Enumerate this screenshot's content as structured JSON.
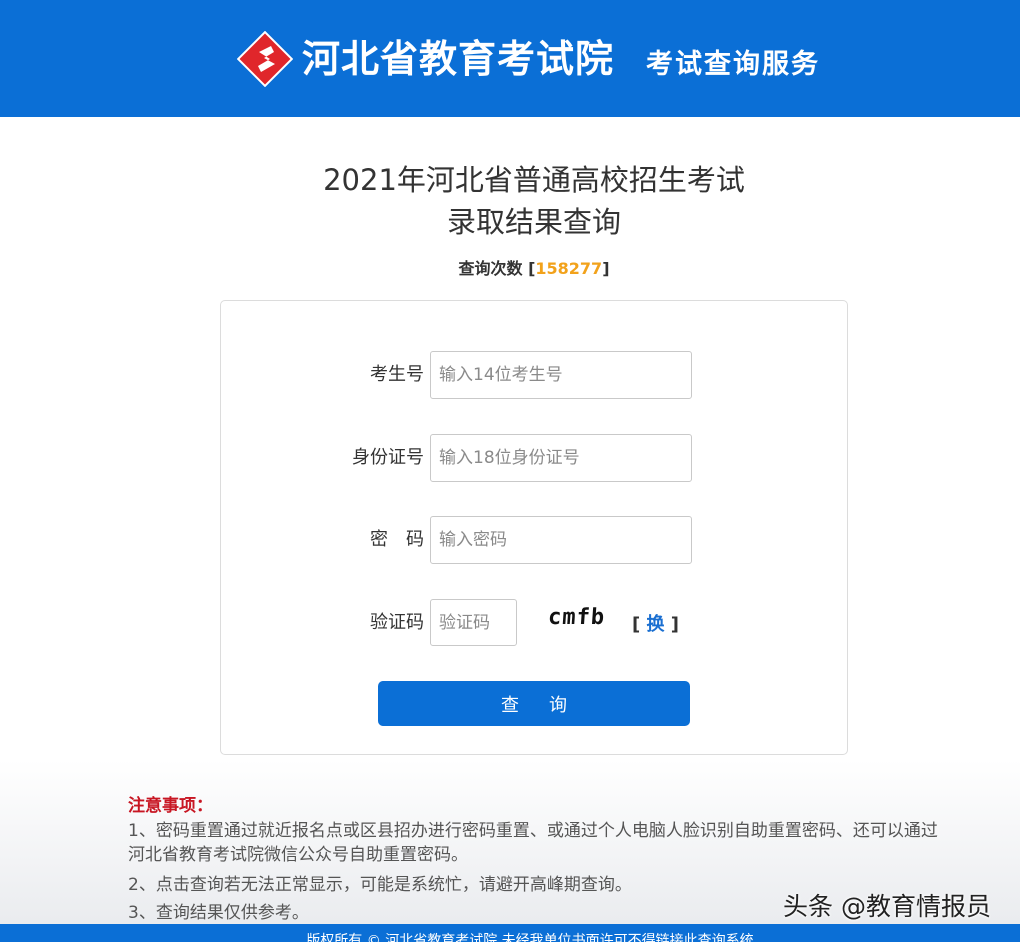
{
  "header": {
    "brand_name": "河北省教育考试院",
    "brand_subtitle": "考试查询服务"
  },
  "page": {
    "title_line1": "2021年河北省普通高校招生考试",
    "title_line2": "录取结果查询",
    "counter_label": "查询次数 [",
    "counter_value": "158277",
    "counter_close": "]"
  },
  "form": {
    "exam_no": {
      "label": "考生号",
      "placeholder": "输入14位考生号",
      "value": ""
    },
    "id_no": {
      "label": "身份证号",
      "placeholder": "输入18位身份证号",
      "value": ""
    },
    "password": {
      "label": "密　码",
      "placeholder": "输入密码",
      "value": ""
    },
    "captcha": {
      "label": "验证码",
      "placeholder": "验证码",
      "value": "",
      "image_text": "cmfb"
    },
    "refresh_open": "[ ",
    "refresh_label": "换",
    "refresh_close": " ]",
    "submit_label": "查询"
  },
  "notes": {
    "title": "注意事项：",
    "items": [
      "1、密码重置通过就近报名点或区县招办进行密码重置、或通过个人电脑人脸识别自助重置密码、还可以通过河北省教育考试院微信公众号自助重置密码。",
      "2、点击查询若无法正常显示，可能是系统忙，请避开高峰期查询。",
      "3、查询结果仅供参考。"
    ]
  },
  "watermark": "头条 @教育情报员",
  "footer": {
    "text": "版权所有 © 河北省教育考试院 未经我单位书面许可不得链接此查询系统"
  },
  "colors": {
    "primary_blue": "#0b6fd6",
    "counter_orange": "#f2a21b",
    "notes_red": "#c81623",
    "logo_red": "#e0262b"
  }
}
